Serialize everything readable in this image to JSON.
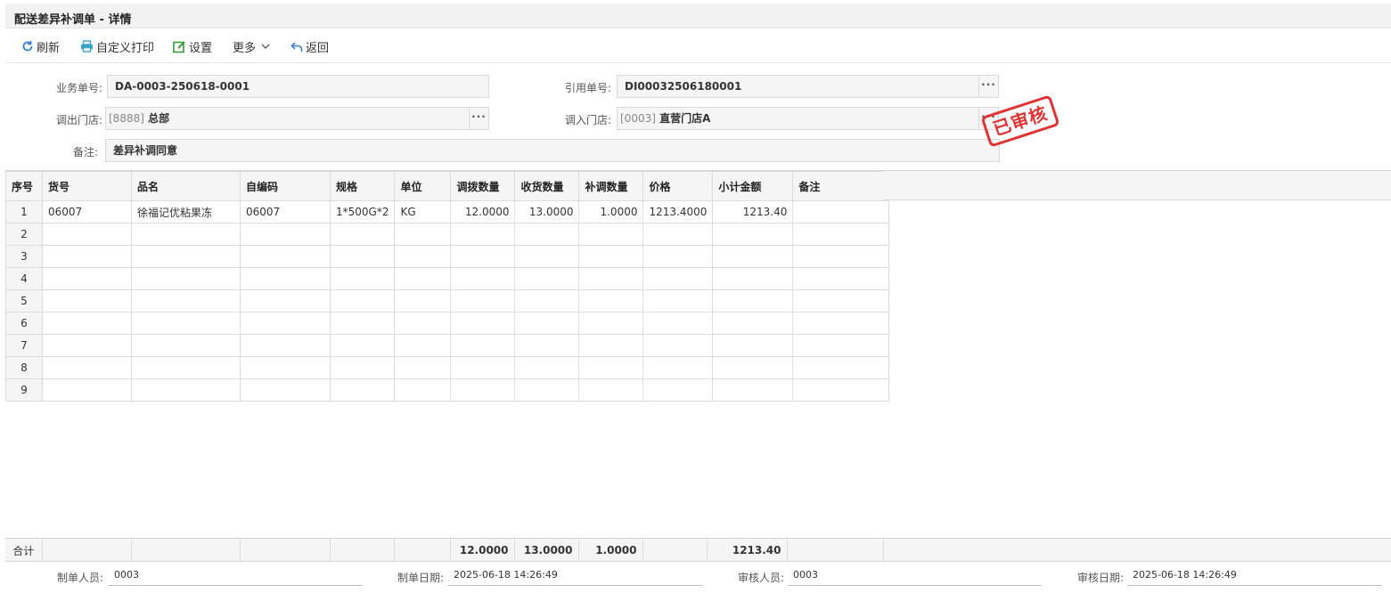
{
  "window": {
    "title": "配送差异补调单 - 详情"
  },
  "toolbar": {
    "refresh": "刷新",
    "custom_print": "自定义打印",
    "settings": "设置",
    "more": "更多",
    "back": "返回"
  },
  "form": {
    "biz_no_label": "业务单号:",
    "biz_no_value": "DA-0003-250618-0001",
    "ref_no_label": "引用单号:",
    "ref_no_value": "DI00032506180001",
    "out_store_label": "调出门店:",
    "out_store_code": "[8888]",
    "out_store_name": "总部",
    "in_store_label": "调入门店:",
    "in_store_code": "[0003]",
    "in_store_name": "直营门店A",
    "remark_label": "备注:",
    "remark_value": "差异补调同意",
    "ellipsis": "···"
  },
  "stamp": {
    "text": "已审核",
    "color": "#e03434"
  },
  "grid": {
    "columns": [
      "序号",
      "货号",
      "品名",
      "自编码",
      "规格",
      "单位",
      "调拨数量",
      "收货数量",
      "补调数量",
      "价格",
      "小计金额",
      "备注"
    ],
    "rows": [
      {
        "idx": "1",
        "sku": "06007",
        "name": "徐福记优粘果冻",
        "code": "06007",
        "spec": "1*500G*2",
        "unit": "KG",
        "transfer_qty": "12.0000",
        "received_qty": "13.0000",
        "adjust_qty": "1.0000",
        "price": "1213.4000",
        "subtotal": "1213.40",
        "remark": ""
      },
      {
        "idx": "2"
      },
      {
        "idx": "3"
      },
      {
        "idx": "4"
      },
      {
        "idx": "5"
      },
      {
        "idx": "6"
      },
      {
        "idx": "7"
      },
      {
        "idx": "8"
      },
      {
        "idx": "9"
      }
    ]
  },
  "totals": {
    "label": "合计",
    "transfer_qty": "12.0000",
    "received_qty": "13.0000",
    "adjust_qty": "1.0000",
    "subtotal": "1213.40"
  },
  "meta": {
    "creator_label": "制单人员:",
    "creator_value": "0003",
    "created_date_label": "制单日期:",
    "created_date_value": "2025-06-18 14:26:49",
    "auditor_label": "审核人员:",
    "auditor_value": "0003",
    "audit_date_label": "审核日期:",
    "audit_date_value": "2025-06-18 14:26:49"
  }
}
